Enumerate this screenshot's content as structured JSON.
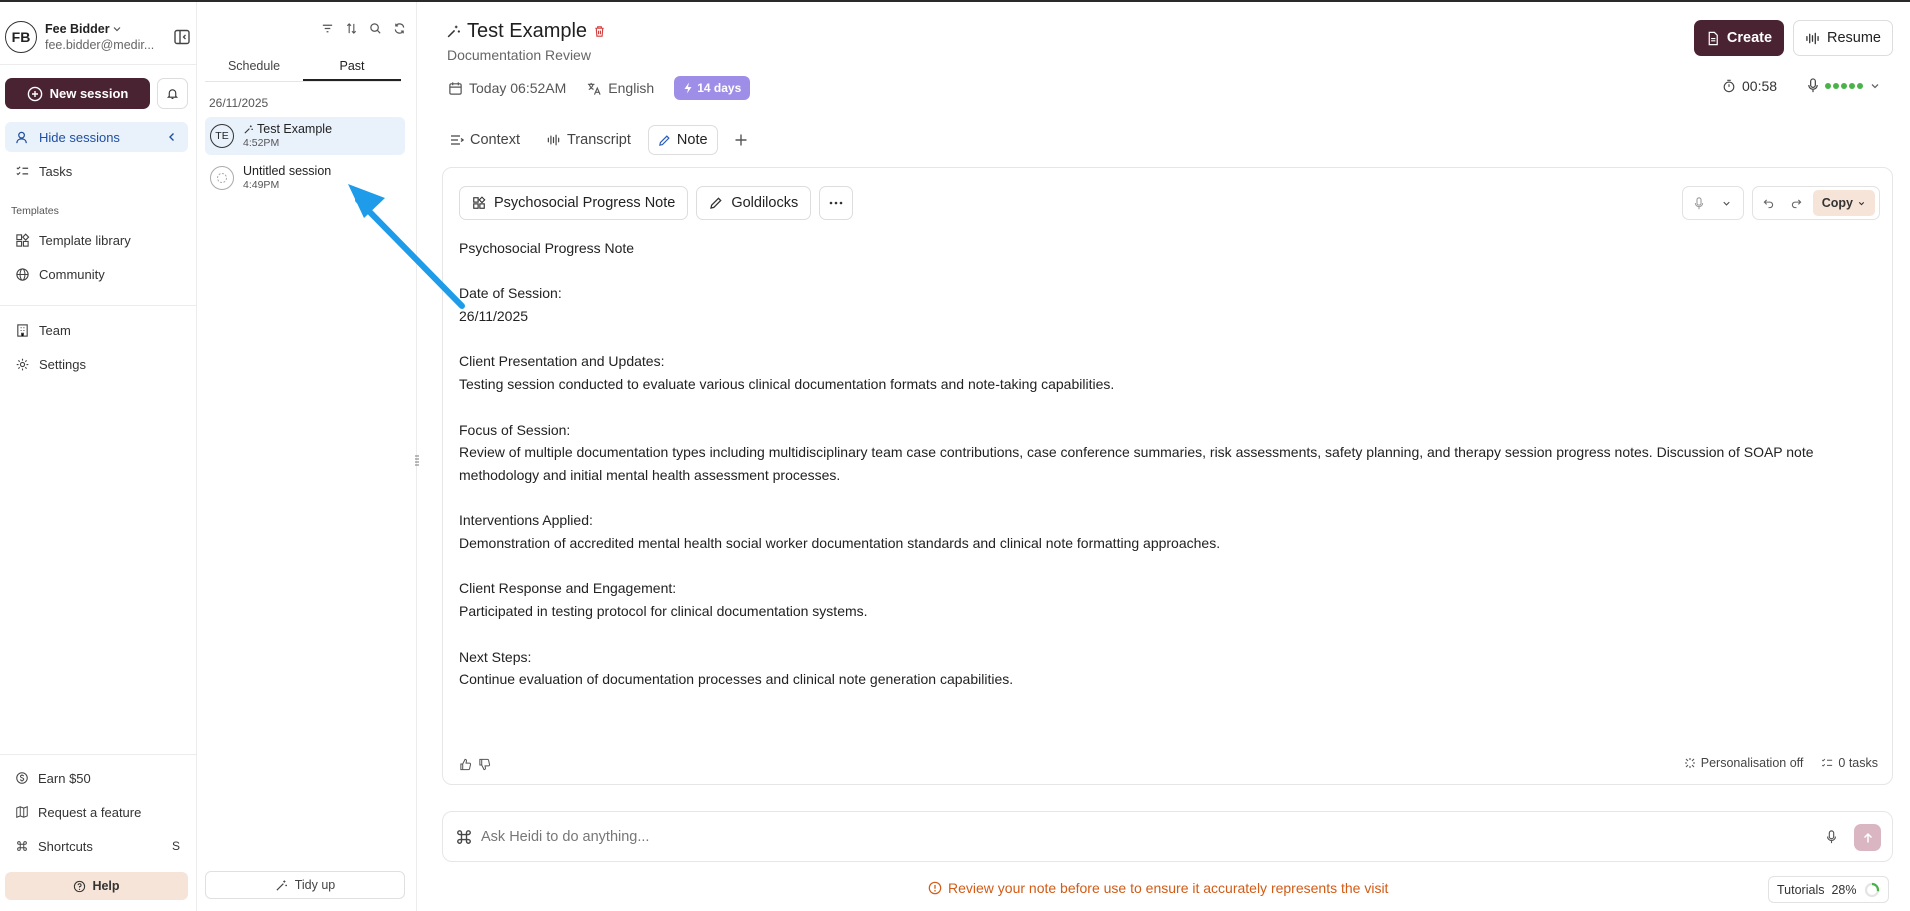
{
  "profile": {
    "initials": "FB",
    "name": "Fee Bidder",
    "email": "fee.bidder@medir..."
  },
  "nav": {
    "new_session": "New session",
    "hide_sessions": "Hide sessions",
    "tasks": "Tasks",
    "templates_section": "Templates",
    "template_library": "Template library",
    "community": "Community",
    "team": "Team",
    "settings": "Settings",
    "earn": "Earn $50",
    "request_feature": "Request a feature",
    "shortcuts": "Shortcuts",
    "shortcuts_key": "S",
    "help": "Help"
  },
  "sessions_panel": {
    "tabs": [
      {
        "label": "Schedule"
      },
      {
        "label": "Past"
      }
    ],
    "date_group": "26/11/2025",
    "items": [
      {
        "initials": "TE",
        "title": "Test Example",
        "time": "4:52PM"
      },
      {
        "initials": "",
        "title": "Untitled session",
        "time": "4:49PM"
      }
    ],
    "tidy_up": "Tidy up"
  },
  "header": {
    "title": "Test Example",
    "subtitle": "Documentation Review",
    "create": "Create",
    "resume": "Resume",
    "date": "Today 06:52AM",
    "language": "English",
    "days_badge": "14 days",
    "timer": "00:58"
  },
  "tabs": [
    {
      "label": "Context"
    },
    {
      "label": "Transcript"
    },
    {
      "label": "Note"
    }
  ],
  "note": {
    "template": "Psychosocial Progress Note",
    "style": "Goldilocks",
    "copy": "Copy",
    "paragraphs": [
      [
        "Psychosocial Progress Note"
      ],
      [
        "Date of Session:",
        "26/11/2025"
      ],
      [
        "Client Presentation and Updates:",
        "Testing session conducted to evaluate various clinical documentation formats and note-taking capabilities."
      ],
      [
        "Focus of Session:",
        "Review of multiple documentation types including multidisciplinary team case contributions, case conference summaries, risk assessments, safety planning, and therapy session progress notes. Discussion of SOAP note methodology and initial mental health assessment processes."
      ],
      [
        "Interventions Applied:",
        "Demonstration of accredited mental health social worker documentation standards and clinical note formatting approaches."
      ],
      [
        "Client Response and Engagement:",
        "Participated in testing protocol for clinical documentation systems."
      ],
      [
        "Next Steps:",
        "Continue evaluation of documentation processes and clinical note generation capabilities."
      ]
    ],
    "personalisation": "Personalisation off",
    "tasks_count": "0 tasks"
  },
  "ask": {
    "placeholder": "Ask Heidi to do anything..."
  },
  "warning": "Review your note before use to ensure it accurately represents the visit",
  "tutorials": {
    "label": "Tutorials",
    "progress": "28%",
    "fraction": 0.28
  },
  "colors": {
    "brand": "#4a2332",
    "active_bg": "#e9f1fb",
    "warning": "#d25b16",
    "days_badge": "#9f8ee8",
    "arrow": "#1e9be9"
  }
}
